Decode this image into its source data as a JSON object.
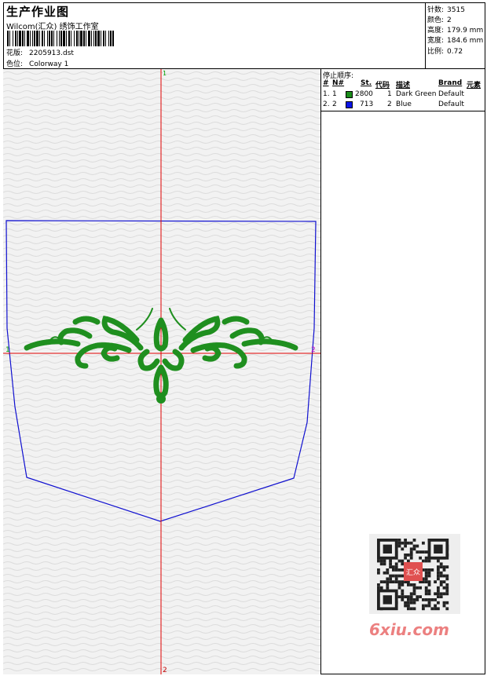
{
  "header": {
    "title": "生产作业图",
    "company": "Wilcom(汇众) 绣饰工作室",
    "design_label": "花版:",
    "design_value": "2205913.dst",
    "colorway_label": "色位:",
    "colorway_value": "Colorway 1"
  },
  "stats": {
    "stitches_label": "针数:",
    "stitches_value": "3515",
    "colors_label": "颜色:",
    "colors_value": "2",
    "height_label": "高度:",
    "height_value": "179.9 mm",
    "width_label": "宽度:",
    "width_value": "184.6 mm",
    "scale_label": "比例:",
    "scale_value": "0.72"
  },
  "stop_sequence": {
    "title": "停止顺序:",
    "columns": [
      "#",
      "N#",
      "St.",
      "代码",
      "描述",
      "Brand",
      "元素"
    ],
    "rows": [
      {
        "index": "1.",
        "needle": "1",
        "color": "#1a8c1a",
        "stitches": "2800",
        "code": "1",
        "description": "Dark Green",
        "brand": "Default"
      },
      {
        "index": "2.",
        "needle": "2",
        "color": "#0a14e6",
        "stitches": "713",
        "code": "2",
        "description": "Blue",
        "brand": "Default"
      }
    ]
  },
  "canvas": {
    "axis_labels": {
      "top": "1",
      "bottom": "2",
      "left": "1",
      "right": "2"
    },
    "colors": {
      "axis": "#e00000",
      "outline": "#1010d0",
      "motif": "#1f8f1f",
      "background": "#f2f2f2"
    }
  },
  "watermark": "6xiu.com",
  "seal_text": "汇众"
}
